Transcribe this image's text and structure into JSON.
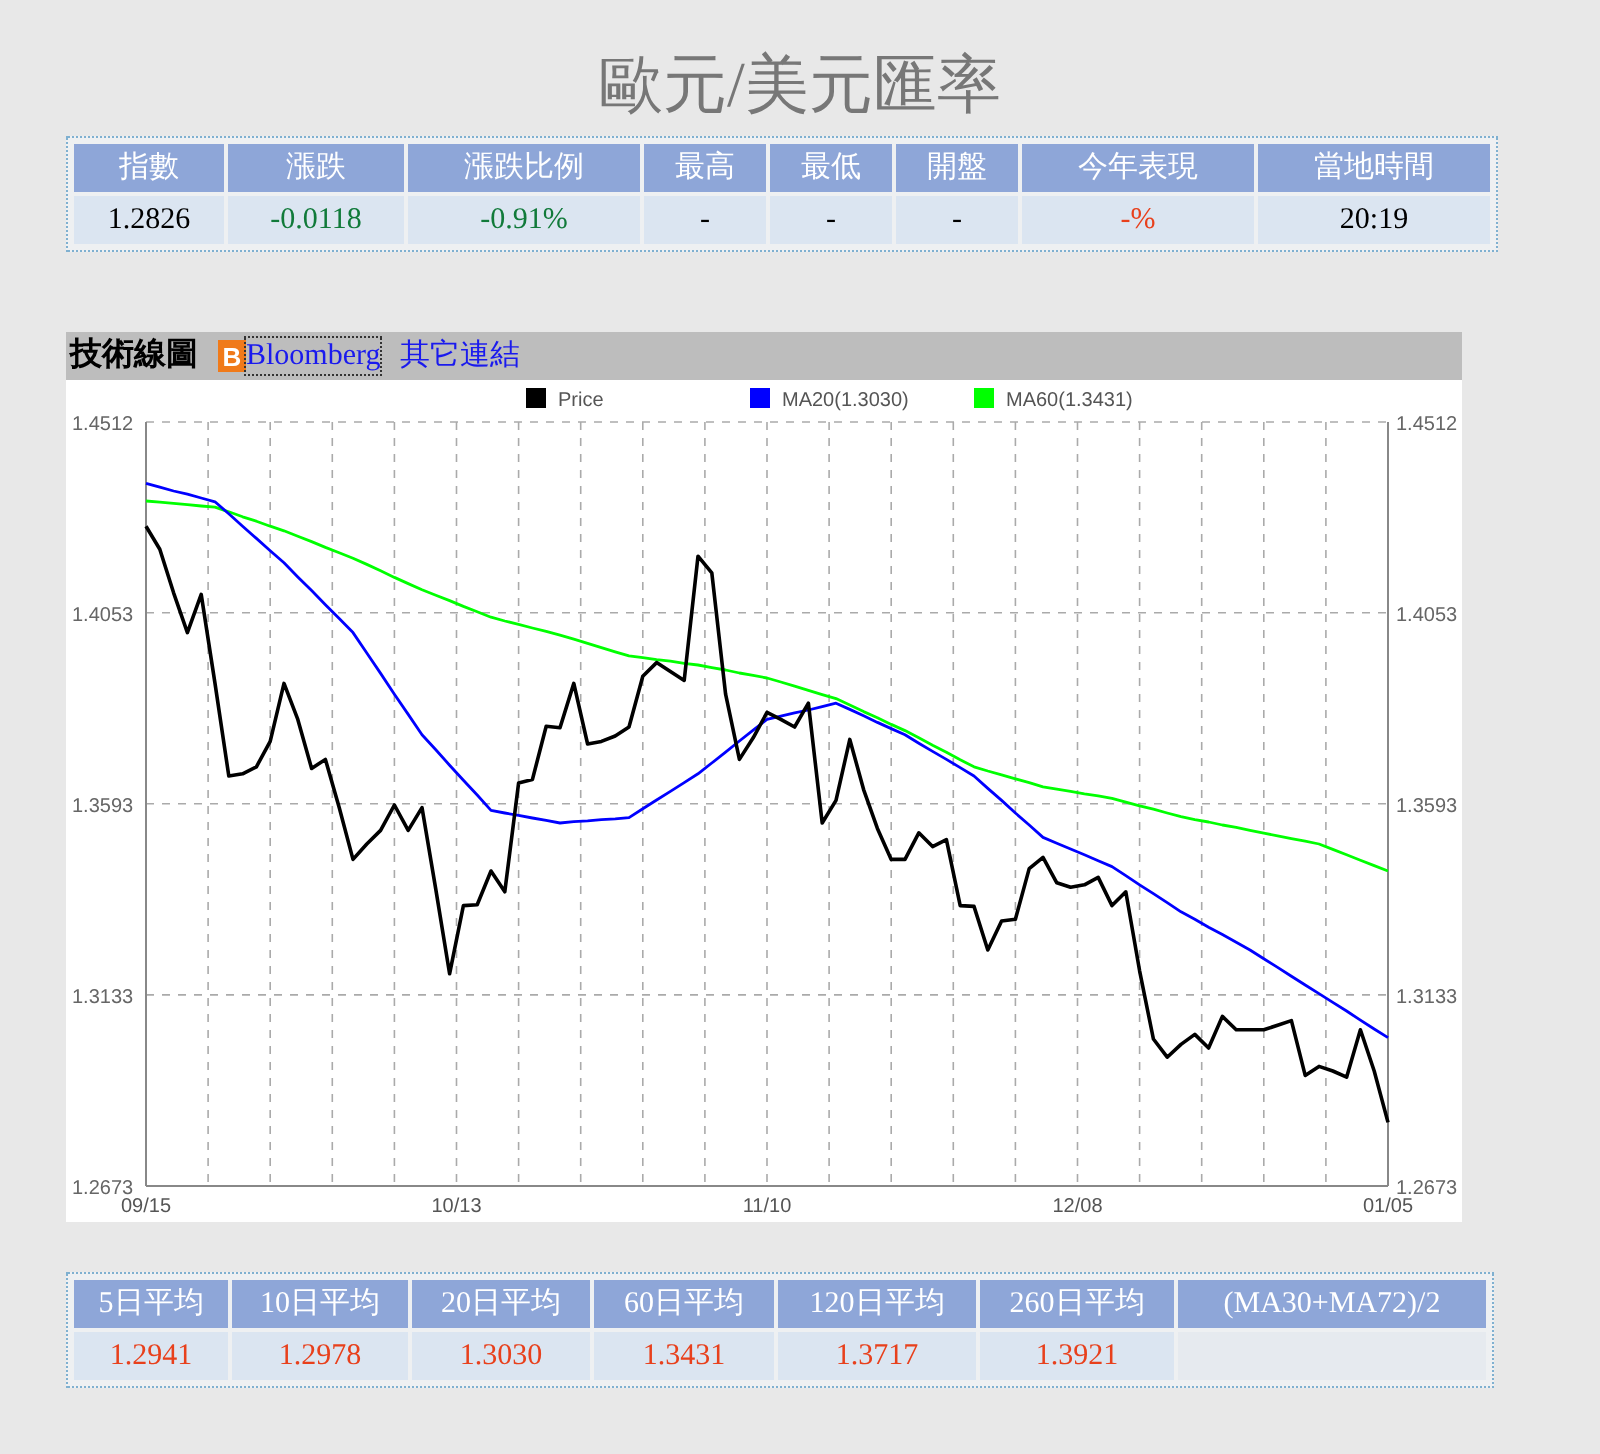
{
  "title": "歐元/美元匯率",
  "quote": {
    "columns": [
      "指數",
      "漲跌",
      "漲跌比例",
      "最高",
      "最低",
      "開盤",
      "今年表現",
      "當地時間"
    ],
    "values": [
      {
        "text": "1.2826",
        "color": "#000000"
      },
      {
        "text": "-0.0118",
        "color": "#117a3a"
      },
      {
        "text": "-0.91%",
        "color": "#117a3a"
      },
      {
        "text": "-",
        "color": "#000000"
      },
      {
        "text": "-",
        "color": "#000000"
      },
      {
        "text": "-",
        "color": "#000000"
      },
      {
        "text": "-%",
        "color": "#e8401c"
      },
      {
        "text": "20:19",
        "color": "#000000"
      }
    ]
  },
  "chart_panel": {
    "heading": "技術線圖",
    "links": [
      {
        "label": "Bloomberg",
        "focused": true,
        "icon": "B"
      },
      {
        "label": "其它連結",
        "focused": false
      }
    ],
    "x_axis_labels": [
      "09/15",
      "10/13",
      "11/10",
      "12/08",
      "01/05"
    ],
    "right_axis_labels": [
      "1.4512",
      "1.4053",
      "1.3593",
      "1.3133",
      "1.2673"
    ],
    "chart_data": {
      "type": "line",
      "ylim": [
        1.2673,
        1.4512
      ],
      "grid": true,
      "legend": true,
      "yticks": [
        1.2673,
        1.3133,
        1.3593,
        1.4053,
        1.4512
      ],
      "series": [
        {
          "name": "Price",
          "color": "#000000",
          "values": [
            1.4261,
            1.4206,
            1.4101,
            1.4005,
            1.4097,
            1.3883,
            1.366,
            1.3665,
            1.3682,
            1.3743,
            1.3883,
            1.3796,
            1.3678,
            1.37,
            1.3584,
            1.3459,
            1.3496,
            1.3529,
            1.359,
            1.3529,
            1.3584,
            1.3387,
            1.3184,
            1.3348,
            1.335,
            1.3431,
            1.3381,
            1.3643,
            1.3651,
            1.378,
            1.3776,
            1.3883,
            1.3737,
            1.3743,
            1.3756,
            1.3778,
            1.39,
            1.3933,
            1.3911,
            1.389,
            1.4189,
            1.4149,
            1.3857,
            1.37,
            1.3752,
            1.3813,
            1.3796,
            1.3778,
            1.3835,
            1.3547,
            1.3601,
            1.3748,
            1.3627,
            1.3534,
            1.3459,
            1.3459,
            1.3523,
            1.349,
            1.3507,
            1.3348,
            1.3346,
            1.3241,
            1.3311,
            1.3315,
            1.3437,
            1.3464,
            1.3403,
            1.3392,
            1.3398,
            1.3416,
            1.3348,
            1.3381,
            1.3191,
            1.3027,
            1.2983,
            1.3014,
            1.3038,
            1.3005,
            1.3081,
            1.3049,
            1.3049,
            1.3049,
            1.306,
            1.3071,
            1.2939,
            1.2961,
            1.295,
            1.2935,
            1.3049,
            1.295,
            1.2826
          ]
        },
        {
          "name": "MA20(1.3030)",
          "color": "#0000ff",
          "values": [
            1.4364,
            1.4355,
            1.4346,
            1.4338,
            1.4329,
            1.432,
            1.4291,
            1.4261,
            1.4232,
            1.4202,
            1.4173,
            1.4139,
            1.4106,
            1.4072,
            1.4039,
            1.4005,
            1.3956,
            1.3907,
            1.3857,
            1.3808,
            1.3759,
            1.3723,
            1.3686,
            1.365,
            1.3614,
            1.3577,
            1.3571,
            1.3565,
            1.3559,
            1.3553,
            1.3547,
            1.355,
            1.3552,
            1.3555,
            1.3557,
            1.356,
            1.3581,
            1.3602,
            1.3623,
            1.3644,
            1.3665,
            1.3691,
            1.3717,
            1.3744,
            1.377,
            1.3796,
            1.3804,
            1.3812,
            1.3819,
            1.3827,
            1.3835,
            1.382,
            1.3805,
            1.3789,
            1.3774,
            1.3759,
            1.3739,
            1.3719,
            1.37,
            1.368,
            1.366,
            1.363,
            1.3601,
            1.3571,
            1.3542,
            1.3512,
            1.3498,
            1.3484,
            1.347,
            1.3456,
            1.3442,
            1.342,
            1.3398,
            1.3377,
            1.3355,
            1.3333,
            1.3315,
            1.3296,
            1.3278,
            1.326,
            1.3241,
            1.322,
            1.3199,
            1.3178,
            1.3157,
            1.3136,
            1.3115,
            1.3094,
            1.3072,
            1.3051,
            1.303
          ]
        },
        {
          "name": "MA60(1.3431)",
          "color": "#00ff00",
          "values": [
            1.4322,
            1.4319,
            1.4316,
            1.4313,
            1.431,
            1.4307,
            1.4296,
            1.4284,
            1.4273,
            1.4261,
            1.425,
            1.4237,
            1.4224,
            1.421,
            1.4197,
            1.4184,
            1.4169,
            1.4154,
            1.4138,
            1.4123,
            1.4108,
            1.4095,
            1.4082,
            1.4068,
            1.4055,
            1.4042,
            1.4033,
            1.4025,
            1.4016,
            1.4008,
            1.3999,
            1.3989,
            1.3979,
            1.3969,
            1.3959,
            1.3949,
            1.3945,
            1.394,
            1.3936,
            1.3931,
            1.3927,
            1.3921,
            1.3915,
            1.3908,
            1.3902,
            1.3896,
            1.3886,
            1.3876,
            1.3866,
            1.3856,
            1.3846,
            1.3831,
            1.3815,
            1.38,
            1.3784,
            1.3769,
            1.3752,
            1.3734,
            1.3717,
            1.3699,
            1.3682,
            1.3672,
            1.3663,
            1.3653,
            1.3644,
            1.3634,
            1.3628,
            1.3623,
            1.3617,
            1.3612,
            1.3606,
            1.3597,
            1.3588,
            1.358,
            1.3571,
            1.3562,
            1.3555,
            1.3549,
            1.3542,
            1.3536,
            1.3529,
            1.3522,
            1.3516,
            1.3509,
            1.3503,
            1.3496,
            1.3483,
            1.347,
            1.3457,
            1.3444,
            1.3431
          ]
        }
      ]
    }
  },
  "averages": {
    "columns": [
      "5日平均",
      "10日平均",
      "20日平均",
      "60日平均",
      "120日平均",
      "260日平均",
      "(MA30+MA72)/2"
    ],
    "values": [
      {
        "text": "1.2941",
        "color": "#e8401c"
      },
      {
        "text": "1.2978",
        "color": "#e8401c"
      },
      {
        "text": "1.3030",
        "color": "#e8401c"
      },
      {
        "text": "1.3431",
        "color": "#e8401c"
      },
      {
        "text": "1.3717",
        "color": "#e8401c"
      },
      {
        "text": "1.3921",
        "color": "#e8401c"
      }
    ]
  }
}
